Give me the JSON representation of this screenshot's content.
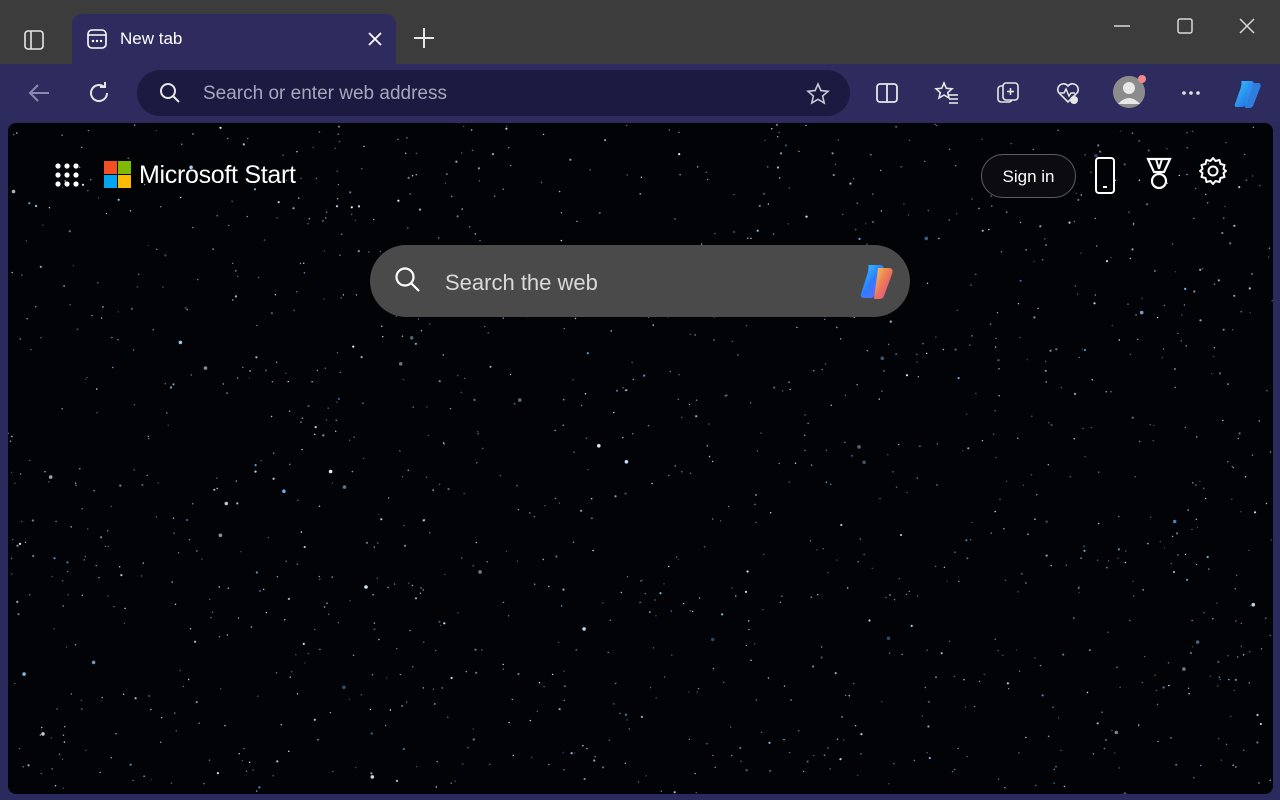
{
  "browser": {
    "tab": {
      "title": "New tab"
    },
    "address_bar": {
      "placeholder": "Search or enter web address"
    },
    "colors": {
      "frame": "#2e2c5e",
      "titlebar": "#3c3c3c",
      "accent": "#5b5fc7"
    }
  },
  "page": {
    "brand": "Microsoft Start",
    "sign_in_label": "Sign in",
    "search": {
      "placeholder": "Search the web"
    },
    "background": "starfield"
  }
}
